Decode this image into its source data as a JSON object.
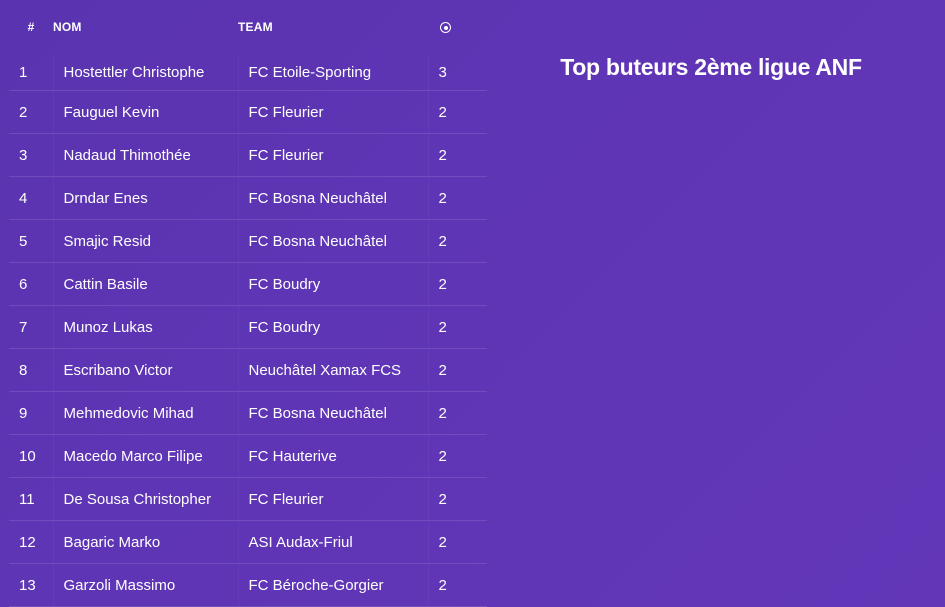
{
  "title": "Top buteurs 2ème ligue ANF",
  "table": {
    "headers": {
      "rank": "#",
      "name": "NOM",
      "team": "TEAM",
      "goals_icon": "soccer-ball-icon"
    },
    "rows": [
      {
        "rank": "1",
        "name": "Hostettler Christophe",
        "team": "FC Etoile-Sporting",
        "goals": "3"
      },
      {
        "rank": "2",
        "name": "Fauguel Kevin",
        "team": "FC Fleurier",
        "goals": "2"
      },
      {
        "rank": "3",
        "name": "Nadaud Thimothée",
        "team": "FC Fleurier",
        "goals": "2"
      },
      {
        "rank": "4",
        "name": "Drndar Enes",
        "team": "FC Bosna Neuchâtel",
        "goals": "2"
      },
      {
        "rank": "5",
        "name": "Smajic Resid",
        "team": "FC Bosna Neuchâtel",
        "goals": "2"
      },
      {
        "rank": "6",
        "name": "Cattin Basile",
        "team": "FC Boudry",
        "goals": "2"
      },
      {
        "rank": "7",
        "name": "Munoz Lukas",
        "team": "FC Boudry",
        "goals": "2"
      },
      {
        "rank": "8",
        "name": "Escribano Victor",
        "team": "Neuchâtel Xamax FCS",
        "goals": "2"
      },
      {
        "rank": "9",
        "name": "Mehmedovic Mihad",
        "team": "FC Bosna Neuchâtel",
        "goals": "2"
      },
      {
        "rank": "10",
        "name": "Macedo Marco Filipe",
        "team": "FC Hauterive",
        "goals": "2"
      },
      {
        "rank": "11",
        "name": "De Sousa Christopher",
        "team": "FC Fleurier",
        "goals": "2"
      },
      {
        "rank": "12",
        "name": "Bagaric Marko",
        "team": "ASI Audax-Friul",
        "goals": "2"
      },
      {
        "rank": "13",
        "name": "Garzoli Massimo",
        "team": "FC Béroche-Gorgier",
        "goals": "2"
      }
    ]
  },
  "colors": {
    "background": "#5f35b5",
    "text": "#ffffff"
  }
}
